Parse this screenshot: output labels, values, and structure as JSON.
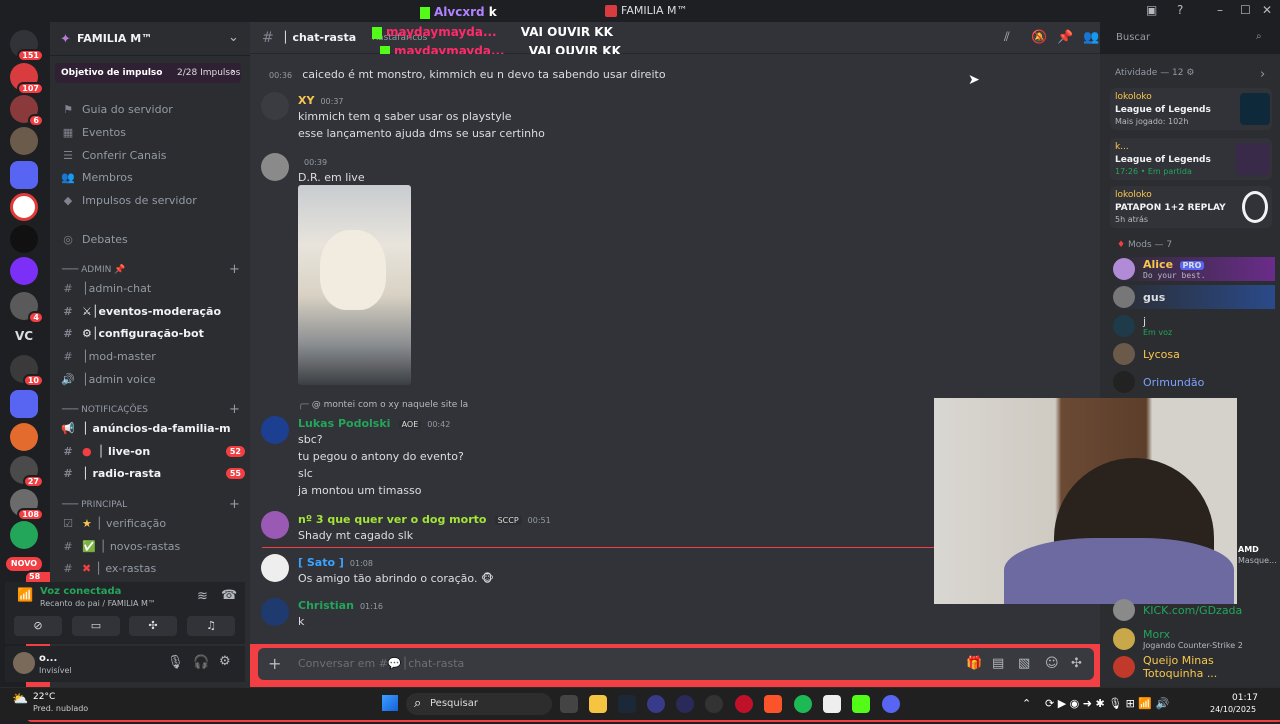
{
  "window": {
    "title": "FAMILIA M™"
  },
  "stream_overlay": {
    "lines": [
      {
        "user": "Alvcxrd",
        "text": "k"
      },
      {
        "user": "maydaymayda...",
        "text": "VAI OUVIR KK"
      },
      {
        "user": "maydaymayda...",
        "text": "VAI OUVIR KK"
      }
    ]
  },
  "rail": {
    "badges": [
      "151",
      "107",
      "6",
      "4",
      "10",
      "27",
      "108",
      "58"
    ],
    "vc_label": "VC",
    "novo_label": "NOVO"
  },
  "guild": {
    "name": "FAMILIA M™",
    "boost_goal": "Objetivo de impulso",
    "boost_progress": "2/28 Impulsos"
  },
  "sidebar": {
    "top_items": [
      "Guia do servidor",
      "Eventos",
      "Conferir Canais",
      "Membros",
      "Impulsos de servidor"
    ],
    "debates": "Debates",
    "categories": {
      "admin": "─── Admin",
      "notificacoes": "─── NOTIFICAÇÕES",
      "principal": "─── PRINCIPAL"
    },
    "admin_channels": [
      "│admin-chat",
      "⚔│eventos-moderação",
      "⚙│configuração-bot",
      "│mod-master",
      "│admin voice"
    ],
    "notif_channels": [
      {
        "name": "│ anúncios-da-familia-m",
        "badge": ""
      },
      {
        "name": "│ live-on",
        "badge": "52"
      },
      {
        "name": "│ radio-rasta",
        "badge": "55"
      }
    ],
    "principal_channels": [
      "│ verificação",
      "│ novos-rastas",
      "│ ex-rastas"
    ]
  },
  "voice": {
    "status": "Voz conectada",
    "location": "Recanto do pai / FAMILIA M™"
  },
  "user": {
    "name": "o...",
    "status": "Invisível"
  },
  "chat": {
    "channel": "│ chat-rasta",
    "channel_topic": "Rastafáricos",
    "messages": [
      {
        "author": "",
        "time": "00:36",
        "lines": [
          "caicedo é mt monstro, kimmich eu n devo ta sabendo usar direito"
        ]
      },
      {
        "author": "XY",
        "time": "00:37",
        "lines": [
          "kimmich tem q saber usar os playstyle",
          "esse lançamento ajuda dms se usar certinho"
        ]
      },
      {
        "author": "",
        "time": "00:39",
        "lines": [
          "D.R. em live"
        ]
      },
      {
        "author": "Lukas Podolski",
        "tag": "AOE",
        "time": "00:42",
        "reply": "@ montei com o xy naquele site la",
        "lines": [
          "sbc?",
          "tu pegou o antony do evento?",
          "slc",
          "ja montou um timasso"
        ]
      },
      {
        "author": "nº 3 que quer ver o dog morto",
        "tag": "SCCP",
        "time": "00:51",
        "lines": [
          "Shady mt cagado slk"
        ]
      },
      {
        "author": "[ Sato ]",
        "time": "01:08",
        "lines": [
          "Os amigo tão abrindo o coração. 🐵"
        ]
      },
      {
        "author": "Christian",
        "time": "01:16",
        "lines": [
          "k"
        ]
      }
    ],
    "input_placeholder": "Conversar em #💬│chat-rasta"
  },
  "search": {
    "placeholder": "Buscar"
  },
  "activity": {
    "header": "Atividade — 12",
    "cards": [
      {
        "user": "lokoloko",
        "game": "League of Legends",
        "detail": "Mais jogado: 102h"
      },
      {
        "user": "k...",
        "game": "League of Legends",
        "detail": "17:26 • Em partida"
      },
      {
        "user": "lokoloko",
        "game": "PATAPON 1+2 REPLAY",
        "detail": "5h atrás"
      }
    ]
  },
  "members": {
    "mods_header": "Mods — 7",
    "list": [
      {
        "name": "Alice",
        "sub": "Do your best.",
        "tag": "PRO",
        "color": "#f9c74f"
      },
      {
        "name": "gus",
        "sub": "",
        "tag": "",
        "color": "#dbdee1"
      },
      {
        "name": "j",
        "sub": "Em voz",
        "tag": "",
        "color": "#dbdee1"
      },
      {
        "name": "Lycosa",
        "sub": "",
        "tag": "",
        "color": "#f9c74f"
      },
      {
        "name": "Orimundão",
        "sub": "",
        "tag": "",
        "color": "#7ea0ff"
      }
    ],
    "bottom": [
      {
        "name": "KICK.com/GDzada",
        "sub": ""
      },
      {
        "name": "Morx",
        "sub": "Jogando Counter-Strike 2"
      },
      {
        "name": "Queijo Minas Totoquinha ...",
        "sub": ""
      }
    ],
    "amd_label": "AMD",
    "masque_label": "Masque..."
  },
  "taskbar": {
    "weather_temp": "22°C",
    "weather_desc": "Pred. nublado",
    "search": "Pesquisar",
    "time": "01:17",
    "date": "24/10/2025"
  }
}
